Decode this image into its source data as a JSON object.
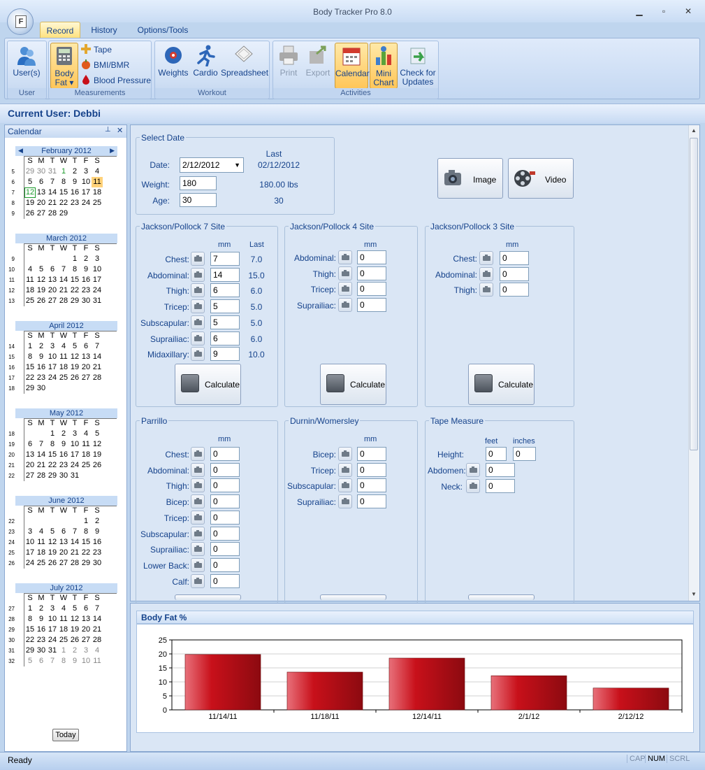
{
  "window": {
    "title": "Body Tracker Pro 8.0",
    "app_button": "F"
  },
  "tabs": [
    {
      "label": "Record",
      "active": true
    },
    {
      "label": "History"
    },
    {
      "label": "Options/Tools"
    }
  ],
  "ribbon": {
    "groups": {
      "user": "User",
      "measurements": "Measurements",
      "workout": "Workout",
      "activities": "Activities"
    },
    "users": "User(s)",
    "body_fat": [
      "Body",
      "Fat ▾"
    ],
    "tape": "Tape",
    "bmi": "BMI/BMR",
    "bp": "Blood Pressure",
    "weights": "Weights",
    "cardio": "Cardio",
    "spreadsheet": "Spreadsheet",
    "print": "Print",
    "export": "Export",
    "calendar": "Calendar",
    "mini_chart": [
      "Mini",
      "Chart"
    ],
    "check_updates": [
      "Check for",
      "Updates"
    ]
  },
  "current_user": "Current User: Debbi",
  "calendar_panel": {
    "title": "Calendar",
    "pin": "⊥",
    "close": "✕",
    "today": "Today",
    "day_headers": [
      "S",
      "M",
      "T",
      "W",
      "T",
      "F",
      "S"
    ],
    "months": [
      {
        "title": "February 2012",
        "nav": true,
        "weeks": [
          {
            "wk": "5",
            "days": [
              "29",
              "30",
              "31",
              "1",
              "2",
              "3",
              "4"
            ],
            "other": [
              0,
              1,
              2
            ]
          },
          {
            "wk": "6",
            "days": [
              "5",
              "6",
              "7",
              "8",
              "9",
              "10",
              "11"
            ]
          },
          {
            "wk": "7",
            "days": [
              "12",
              "13",
              "14",
              "15",
              "16",
              "17",
              "18"
            ]
          },
          {
            "wk": "8",
            "days": [
              "19",
              "20",
              "21",
              "22",
              "23",
              "24",
              "25"
            ]
          },
          {
            "wk": "9",
            "days": [
              "26",
              "27",
              "28",
              "29",
              "",
              "",
              ""
            ]
          }
        ]
      },
      {
        "title": "March 2012",
        "weeks": [
          {
            "wk": "9",
            "days": [
              "",
              "",
              "",
              "",
              "1",
              "2",
              "3"
            ]
          },
          {
            "wk": "10",
            "days": [
              "4",
              "5",
              "6",
              "7",
              "8",
              "9",
              "10"
            ]
          },
          {
            "wk": "11",
            "days": [
              "11",
              "12",
              "13",
              "14",
              "15",
              "16",
              "17"
            ]
          },
          {
            "wk": "12",
            "days": [
              "18",
              "19",
              "20",
              "21",
              "22",
              "23",
              "24"
            ]
          },
          {
            "wk": "13",
            "days": [
              "25",
              "26",
              "27",
              "28",
              "29",
              "30",
              "31"
            ]
          }
        ]
      },
      {
        "title": "April 2012",
        "weeks": [
          {
            "wk": "14",
            "days": [
              "1",
              "2",
              "3",
              "4",
              "5",
              "6",
              "7"
            ]
          },
          {
            "wk": "15",
            "days": [
              "8",
              "9",
              "10",
              "11",
              "12",
              "13",
              "14"
            ]
          },
          {
            "wk": "16",
            "days": [
              "15",
              "16",
              "17",
              "18",
              "19",
              "20",
              "21"
            ]
          },
          {
            "wk": "17",
            "days": [
              "22",
              "23",
              "24",
              "25",
              "26",
              "27",
              "28"
            ]
          },
          {
            "wk": "18",
            "days": [
              "29",
              "30",
              "",
              "",
              "",
              "",
              ""
            ]
          }
        ]
      },
      {
        "title": "May 2012",
        "weeks": [
          {
            "wk": "18",
            "days": [
              "",
              "",
              "1",
              "2",
              "3",
              "4",
              "5"
            ]
          },
          {
            "wk": "19",
            "days": [
              "6",
              "7",
              "8",
              "9",
              "10",
              "11",
              "12"
            ]
          },
          {
            "wk": "20",
            "days": [
              "13",
              "14",
              "15",
              "16",
              "17",
              "18",
              "19"
            ]
          },
          {
            "wk": "21",
            "days": [
              "20",
              "21",
              "22",
              "23",
              "24",
              "25",
              "26"
            ]
          },
          {
            "wk": "22",
            "days": [
              "27",
              "28",
              "29",
              "30",
              "31",
              "",
              ""
            ]
          }
        ]
      },
      {
        "title": "June 2012",
        "weeks": [
          {
            "wk": "22",
            "days": [
              "",
              "",
              "",
              "",
              "",
              "1",
              "2"
            ]
          },
          {
            "wk": "23",
            "days": [
              "3",
              "4",
              "5",
              "6",
              "7",
              "8",
              "9"
            ]
          },
          {
            "wk": "24",
            "days": [
              "10",
              "11",
              "12",
              "13",
              "14",
              "15",
              "16"
            ]
          },
          {
            "wk": "25",
            "days": [
              "17",
              "18",
              "19",
              "20",
              "21",
              "22",
              "23"
            ]
          },
          {
            "wk": "26",
            "days": [
              "24",
              "25",
              "26",
              "27",
              "28",
              "29",
              "30"
            ]
          }
        ]
      },
      {
        "title": "July 2012",
        "weeks": [
          {
            "wk": "27",
            "days": [
              "1",
              "2",
              "3",
              "4",
              "5",
              "6",
              "7"
            ]
          },
          {
            "wk": "28",
            "days": [
              "8",
              "9",
              "10",
              "11",
              "12",
              "13",
              "14"
            ]
          },
          {
            "wk": "29",
            "days": [
              "15",
              "16",
              "17",
              "18",
              "19",
              "20",
              "21"
            ]
          },
          {
            "wk": "30",
            "days": [
              "22",
              "23",
              "24",
              "25",
              "26",
              "27",
              "28"
            ]
          },
          {
            "wk": "31",
            "days": [
              "29",
              "30",
              "31",
              "1",
              "2",
              "3",
              "4"
            ],
            "other": [
              3,
              4,
              5,
              6
            ]
          },
          {
            "wk": "32",
            "days": [
              "5",
              "6",
              "7",
              "8",
              "9",
              "10",
              "11"
            ],
            "other": [
              0,
              1,
              2,
              3,
              4,
              5,
              6
            ]
          }
        ]
      }
    ]
  },
  "select_date": {
    "title": "Select Date",
    "last_label": "Last",
    "date_label": "Date:",
    "date_value": "2/12/2012",
    "date_last": "02/12/2012",
    "weight_label": "Weight:",
    "weight_value": "180",
    "weight_last": "180.00 lbs",
    "age_label": "Age:",
    "age_value": "30",
    "age_last": "30"
  },
  "media": {
    "image": "Image",
    "video": "Video"
  },
  "mm": "mm",
  "calculate": "Calculate",
  "jp7": {
    "title": "Jackson/Pollock 7 Site",
    "last_label": "Last",
    "rows": [
      {
        "label": "Chest:",
        "value": "7",
        "last": "7.0"
      },
      {
        "label": "Abdominal:",
        "value": "14",
        "last": "15.0"
      },
      {
        "label": "Thigh:",
        "value": "6",
        "last": "6.0"
      },
      {
        "label": "Tricep:",
        "value": "5",
        "last": "5.0"
      },
      {
        "label": "Subscapular:",
        "value": "5",
        "last": "5.0"
      },
      {
        "label": "Suprailiac:",
        "value": "6",
        "last": "6.0"
      },
      {
        "label": "Midaxillary:",
        "value": "9",
        "last": "10.0"
      }
    ]
  },
  "jp4": {
    "title": "Jackson/Pollock 4 Site",
    "rows": [
      {
        "label": "Abdominal:",
        "value": "0"
      },
      {
        "label": "Thigh:",
        "value": "0"
      },
      {
        "label": "Tricep:",
        "value": "0"
      },
      {
        "label": "Suprailiac:",
        "value": "0"
      }
    ]
  },
  "jp3": {
    "title": "Jackson/Pollock 3 Site",
    "rows": [
      {
        "label": "Chest:",
        "value": "0"
      },
      {
        "label": "Abdominal:",
        "value": "0"
      },
      {
        "label": "Thigh:",
        "value": "0"
      }
    ]
  },
  "parrillo": {
    "title": "Parrillo",
    "rows": [
      {
        "label": "Chest:",
        "value": "0"
      },
      {
        "label": "Abdominal:",
        "value": "0"
      },
      {
        "label": "Thigh:",
        "value": "0"
      },
      {
        "label": "Bicep:",
        "value": "0"
      },
      {
        "label": "Tricep:",
        "value": "0"
      },
      {
        "label": "Subscapular:",
        "value": "0"
      },
      {
        "label": "Suprailiac:",
        "value": "0"
      },
      {
        "label": "Lower Back:",
        "value": "0"
      },
      {
        "label": "Calf:",
        "value": "0"
      }
    ]
  },
  "durnin": {
    "title": "Durnin/Womersley",
    "rows": [
      {
        "label": "Bicep:",
        "value": "0"
      },
      {
        "label": "Tricep:",
        "value": "0"
      },
      {
        "label": "Subscapular:",
        "value": "0"
      },
      {
        "label": "Suprailiac:",
        "value": "0"
      }
    ]
  },
  "tape_measure": {
    "title": "Tape Measure",
    "feet_label": "feet",
    "inches_label": "inches",
    "height_label": "Height:",
    "height_feet": "0",
    "height_inches": "0",
    "abdomen_label": "Abdomen:",
    "abdomen_value": "0",
    "neck_label": "Neck:",
    "neck_value": "0"
  },
  "chart_data": {
    "type": "bar",
    "title": "Body Fat %",
    "categories": [
      "11/14/11",
      "11/18/11",
      "12/14/11",
      "2/1/12",
      "2/12/12"
    ],
    "values": [
      19.8,
      13.5,
      18.5,
      12.2,
      7.8
    ],
    "ylim": [
      0,
      25
    ],
    "yticks": [
      0,
      5,
      10,
      15,
      20,
      25
    ],
    "grid": true,
    "bar_color": "#c8101a"
  },
  "status": {
    "text": "Ready",
    "indicators": [
      {
        "label": "CAP",
        "on": false
      },
      {
        "label": "NUM",
        "on": true
      },
      {
        "label": "SCRL",
        "on": false
      }
    ]
  }
}
